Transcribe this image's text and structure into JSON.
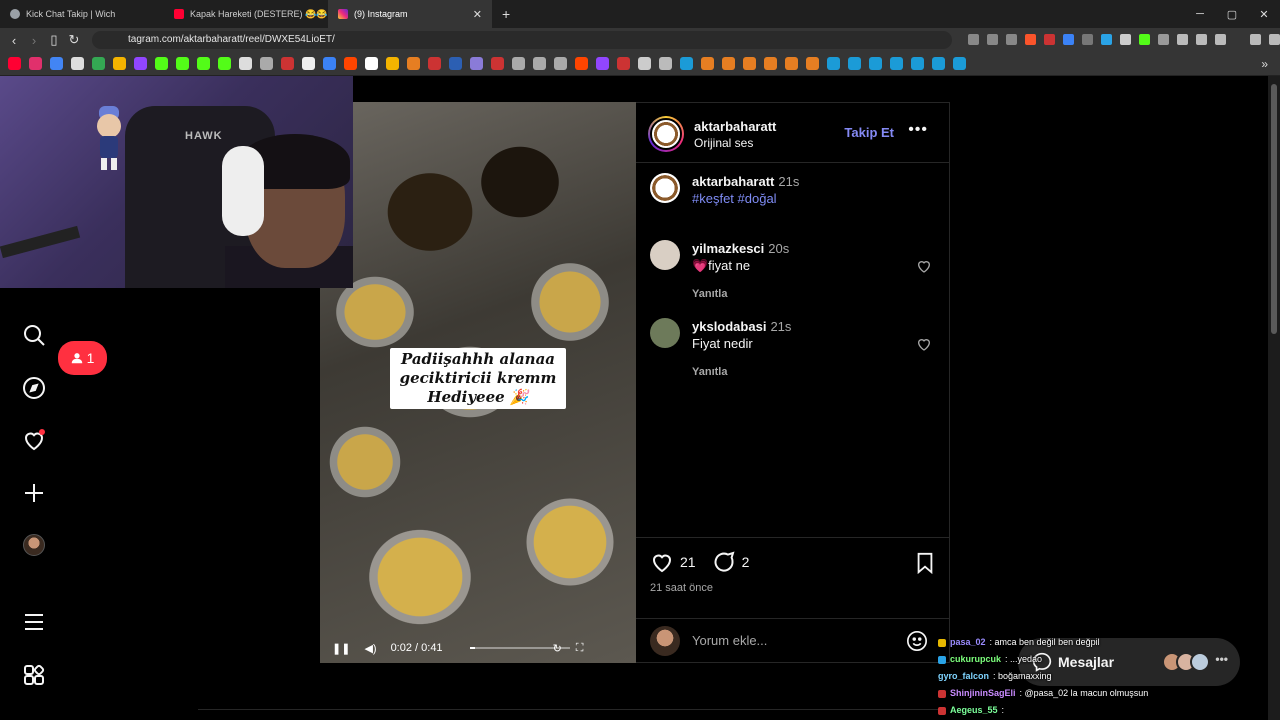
{
  "browser": {
    "tabs": [
      {
        "title": "Kick Chat Takip | Wich",
        "active": false,
        "favicon_color": "#9aa0a6"
      },
      {
        "title": "Kapak Hareketi (DESTERE) 😂😂😂",
        "active": false,
        "favicon_color": "#ff0033"
      },
      {
        "title": "(9) Instagram",
        "active": true,
        "favicon_color": "#e1306c"
      }
    ],
    "url": "tagram.com/aktarbaharatt/reel/DWXE54LioET/",
    "window_controls": [
      "─",
      "▢",
      "✕"
    ]
  },
  "post": {
    "username": "aktarbaharatt",
    "audio": "Orijinal ses",
    "follow_label": "Takip Et",
    "more_label": "•••",
    "caption_user": "aktarbaharatt",
    "caption_time": "21s",
    "caption_tags": "#keşfet #doğal",
    "likes": "21",
    "comments_count": "2",
    "time_ago": "21 saat önce",
    "comment_placeholder": "Yorum ekle..."
  },
  "comments": [
    {
      "user": "yilmazkesci",
      "time": "20s",
      "text": "💗fiyat ne",
      "reply": "Yanıtla",
      "avatar_color": "#d9cfc4"
    },
    {
      "user": "ykslodabasi",
      "time": "21s",
      "text": "Fiyat nedir",
      "reply": "Yanıtla",
      "avatar_color": "#6d7a5a"
    }
  ],
  "reel": {
    "overlay_text_1": "Padiişahhh alanaa",
    "overlay_text_2": "geciktiricii kremm",
    "overlay_text_3": "Hediyeee 🎉",
    "time": "0:02 / 0:41",
    "progress": 0.05
  },
  "sidebar": {
    "notification_count": "1"
  },
  "webcam": {
    "chair_label": "HAWK"
  },
  "messages": {
    "label": "Mesajlar"
  },
  "chat": [
    {
      "user": "pasa_02",
      "text": ": amca ben değil ben değpil",
      "color": "#9b8cff"
    },
    {
      "user": "cukurupcuk",
      "text": ": ...yedao",
      "color": "#7cff7c"
    },
    {
      "user": "gyro_falcon",
      "text": ": boğamaxxing",
      "color": "#7fd4ff"
    },
    {
      "user": "ShinjininSagEli",
      "text": ": @pasa_02 la macun olmuşsun",
      "color": "#c98bff"
    },
    {
      "user": "Aegeus_55",
      "text": ":",
      "color": "#7cff9a"
    }
  ]
}
